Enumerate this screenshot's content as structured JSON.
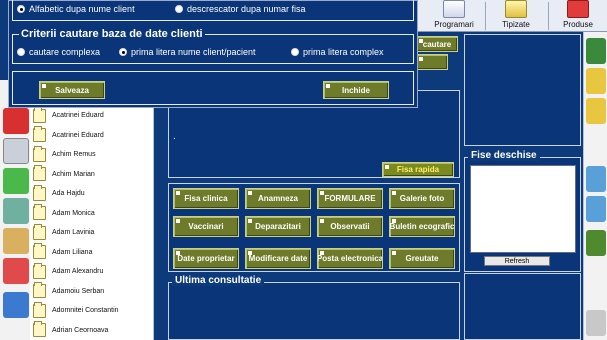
{
  "toolbar": {
    "items": [
      {
        "label": "Programari",
        "icon": "calendar-icon"
      },
      {
        "label": "Tipizate",
        "icon": "document-icon"
      },
      {
        "label": "Produse",
        "icon": "first-aid-kit-icon"
      }
    ]
  },
  "dialog": {
    "sort_options": [
      {
        "label": "Alfabetic dupa nume client",
        "selected": true
      },
      {
        "label": "descrescator dupa numar fisa",
        "selected": false
      }
    ],
    "criteria_title": "Criterii cautare baza de date clienti",
    "criteria_options": [
      {
        "label": "cautare complexa",
        "selected": false
      },
      {
        "label": "prima litera nume client/pacient",
        "selected": true
      },
      {
        "label": "prima litera complex",
        "selected": false
      }
    ],
    "save_label": "Salveaza",
    "close_label": "Inchide"
  },
  "clients": [
    "Acatrinei Eduard",
    "Acatrinei Eduard",
    "Achim Remus",
    "Achim Marian",
    "Ada Hajdu",
    "Adam Monica",
    "Adam  Lavinia",
    "Adam Liliana",
    "Adam Alexandru",
    "Adamoiu Serban",
    "Adomnitei Constantin",
    "Adrian Ceornoava"
  ],
  "main": {
    "hidden_button_label": "cautare",
    "dot_text": ".",
    "fisa_rapida_label": "Fisa rapida",
    "grid_buttons": [
      {
        "label": "Fisa clinica"
      },
      {
        "label": "Anamneza"
      },
      {
        "label": "FORMULARE"
      },
      {
        "label": "Galerie foto"
      },
      {
        "label": "Vaccinari"
      },
      {
        "label": "Deparazitari"
      },
      {
        "label": "Observatii"
      },
      {
        "label": "Buletin ecografic"
      },
      {
        "label": "Date proprietar"
      },
      {
        "label": "Modificare date"
      },
      {
        "label": "Posta electronica"
      },
      {
        "label": "Greutate"
      }
    ],
    "ultima_consultatie_title": "Ultima consultatie",
    "fise_deschise_title": "Fise deschise",
    "refresh_label": "Refresh"
  },
  "colors": {
    "background": "#0d3a7a",
    "button_olive": "#6e7b2a",
    "fisa_rapida": "#7a8a1e"
  }
}
